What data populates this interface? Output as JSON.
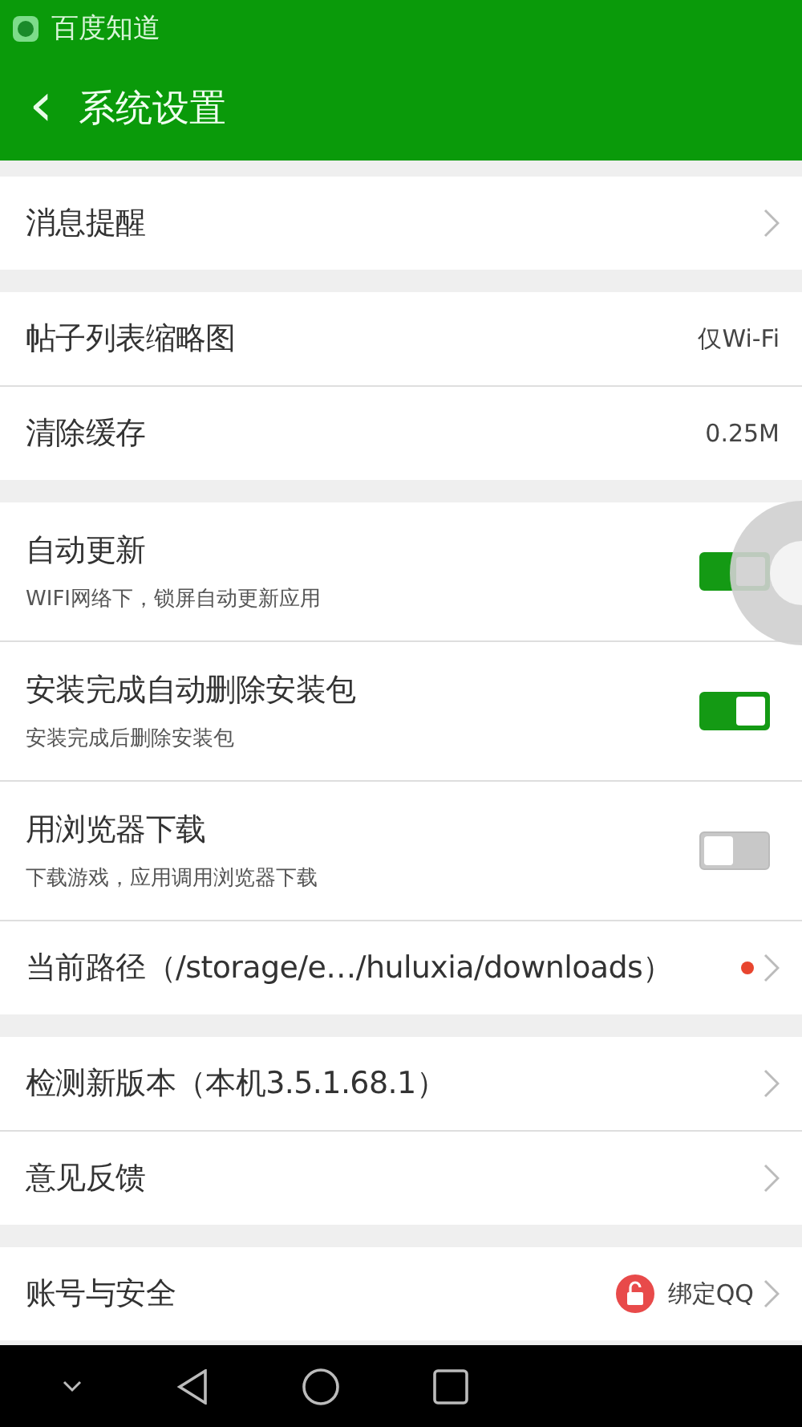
{
  "status_bar": {
    "app_name": "百度知道"
  },
  "header": {
    "back": "‹",
    "title": "系统设置"
  },
  "groups": [
    {
      "rows": [
        {
          "kind": "link",
          "label": "消息提醒"
        }
      ]
    },
    {
      "rows": [
        {
          "kind": "value",
          "label": "帖子列表缩略图",
          "value": "仅Wi-Fi"
        },
        {
          "kind": "value",
          "label": "清除缓存",
          "value": "0.25M"
        }
      ]
    },
    {
      "rows": [
        {
          "kind": "toggle",
          "label": "自动更新",
          "subtitle": "WIFI网络下，锁屏自动更新应用",
          "on": true
        },
        {
          "kind": "toggle",
          "label": "安装完成自动删除安装包",
          "subtitle": "安装完成后删除安装包",
          "on": true
        },
        {
          "kind": "toggle",
          "label": "用浏览器下载",
          "subtitle": "下载游戏，应用调用浏览器下载",
          "on": false
        },
        {
          "kind": "path",
          "label": "当前路径（/storage/e…/huluxia/downloads）"
        }
      ]
    },
    {
      "rows": [
        {
          "kind": "link",
          "label": "检测新版本（本机3.5.1.68.1）"
        },
        {
          "kind": "link",
          "label": "意见反馈"
        }
      ]
    },
    {
      "rows": [
        {
          "kind": "lock",
          "label": "账号与安全",
          "value": "绑定QQ"
        }
      ]
    }
  ]
}
